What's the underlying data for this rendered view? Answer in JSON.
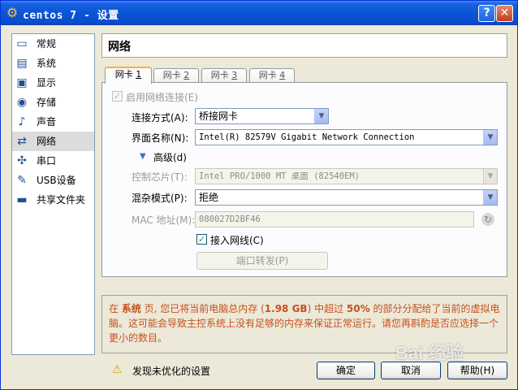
{
  "window": {
    "title": "centos 7 - 设置",
    "help": "?",
    "close": "✕"
  },
  "sidebar": {
    "items": [
      {
        "label": "常规",
        "icon": "▭"
      },
      {
        "label": "系统",
        "icon": "▤"
      },
      {
        "label": "显示",
        "icon": "▣"
      },
      {
        "label": "存储",
        "icon": "◉"
      },
      {
        "label": "声音",
        "icon": "♪"
      },
      {
        "label": "网络",
        "icon": "⇄"
      },
      {
        "label": "串口",
        "icon": "✣"
      },
      {
        "label": "USB设备",
        "icon": "✎"
      },
      {
        "label": "共享文件夹",
        "icon": "▬"
      }
    ],
    "selected": "网络"
  },
  "header": {
    "title": "网络"
  },
  "tabs": [
    {
      "label": "网卡 ",
      "num": "1"
    },
    {
      "label": "网卡 ",
      "num": "2"
    },
    {
      "label": "网卡 ",
      "num": "3"
    },
    {
      "label": "网卡 ",
      "num": "4"
    }
  ],
  "form": {
    "enable_label": "启用网络连接(E)",
    "attach_label": "连接方式(A):",
    "attach_value": "桥接网卡",
    "name_label": "界面名称(N):",
    "name_value": "Intel(R) 82579V Gigabit Network Connection",
    "advanced_label": "高级(d)",
    "adapter_label": "控制芯片(T):",
    "adapter_value": "Intel PRO/1000 MT 桌面 (82540EM)",
    "promisc_label": "混杂模式(P):",
    "promisc_value": "拒绝",
    "mac_label": "MAC 地址(M):",
    "mac_value": "080027D2BF46",
    "cable_label": "接入网线(C)",
    "port_forward_label": "端口转发(P)"
  },
  "warning": {
    "prefix": "在 ",
    "page": "系统",
    "mid1": " 页, 您已将当前电脑总内存 (",
    "mem": "1.98 GB",
    "mid2": ") 中超过 ",
    "pct": "50%",
    "rest": " 的部分分配给了当前的虚拟电脑。这可能会导致主控系统上没有足够的内存来保证正常运行。请您再斟酌是否应选择一个更小的数目。"
  },
  "status": {
    "text": "发现未优化的设置"
  },
  "buttons": {
    "ok": "确定",
    "cancel": "取消",
    "help": "帮助(H)"
  },
  "watermark": "Bai 经验"
}
